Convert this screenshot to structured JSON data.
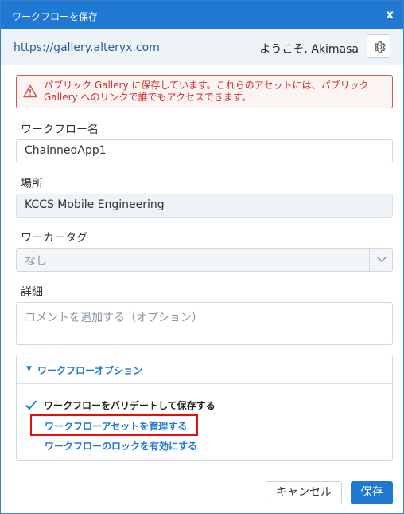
{
  "dialog": {
    "title": "ワークフローを保存",
    "close_label": "x"
  },
  "host": {
    "url": "https://gallery.alteryx.com",
    "welcome": "ようこそ, Akimasa",
    "settings_icon": "gear-icon"
  },
  "alert": {
    "icon": "warning-icon",
    "text": "パブリック Gallery に保存しています。これらのアセットには、パブリック Gallery へのリンクで誰でもアクセスできます。",
    "color": "#d9534f"
  },
  "form": {
    "name_label": "ワークフロー名",
    "name_value": "ChainnedApp1",
    "location_label": "場所",
    "location_value": "KCCS Mobile Engineering",
    "tag_label": "ワーカータグ",
    "tag_value": "なし",
    "details_label": "詳細",
    "details_placeholder": "コメントを追加する（オプション）"
  },
  "options": {
    "header": "ワークフローオプション",
    "validate_label": "ワークフローをバリデートして保存する",
    "validate_checked": true,
    "manage_assets_link": "ワークフローアセットを管理する",
    "lock_link": "ワークフローのロックを有効にする"
  },
  "buttons": {
    "cancel": "キャンセル",
    "save": "保存"
  },
  "colors": {
    "accent": "#1f78d1",
    "highlight": "#e01010"
  }
}
